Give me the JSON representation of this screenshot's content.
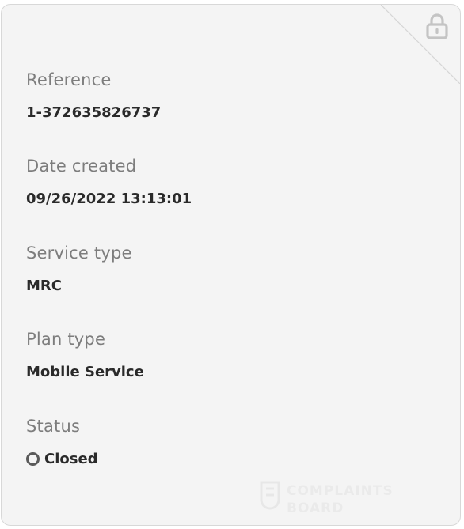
{
  "fields": [
    {
      "label": "Reference",
      "value": "1-372635826737"
    },
    {
      "label": "Date created",
      "value": "09/26/2022 13:13:01"
    },
    {
      "label": "Service type",
      "value": "MRC"
    },
    {
      "label": "Plan type",
      "value": "Mobile Service"
    },
    {
      "label": "Status",
      "value": "Closed"
    }
  ],
  "icons": {
    "lock": "lock-icon",
    "status": "status-circle-icon"
  },
  "colors": {
    "card_bg": "#f4f4f4",
    "label": "#7d7d7d",
    "value": "#2a2a2a",
    "lock": "#c4c4c4"
  },
  "watermark": {
    "line1": "COMPLAINTS",
    "line2": "BOARD"
  }
}
